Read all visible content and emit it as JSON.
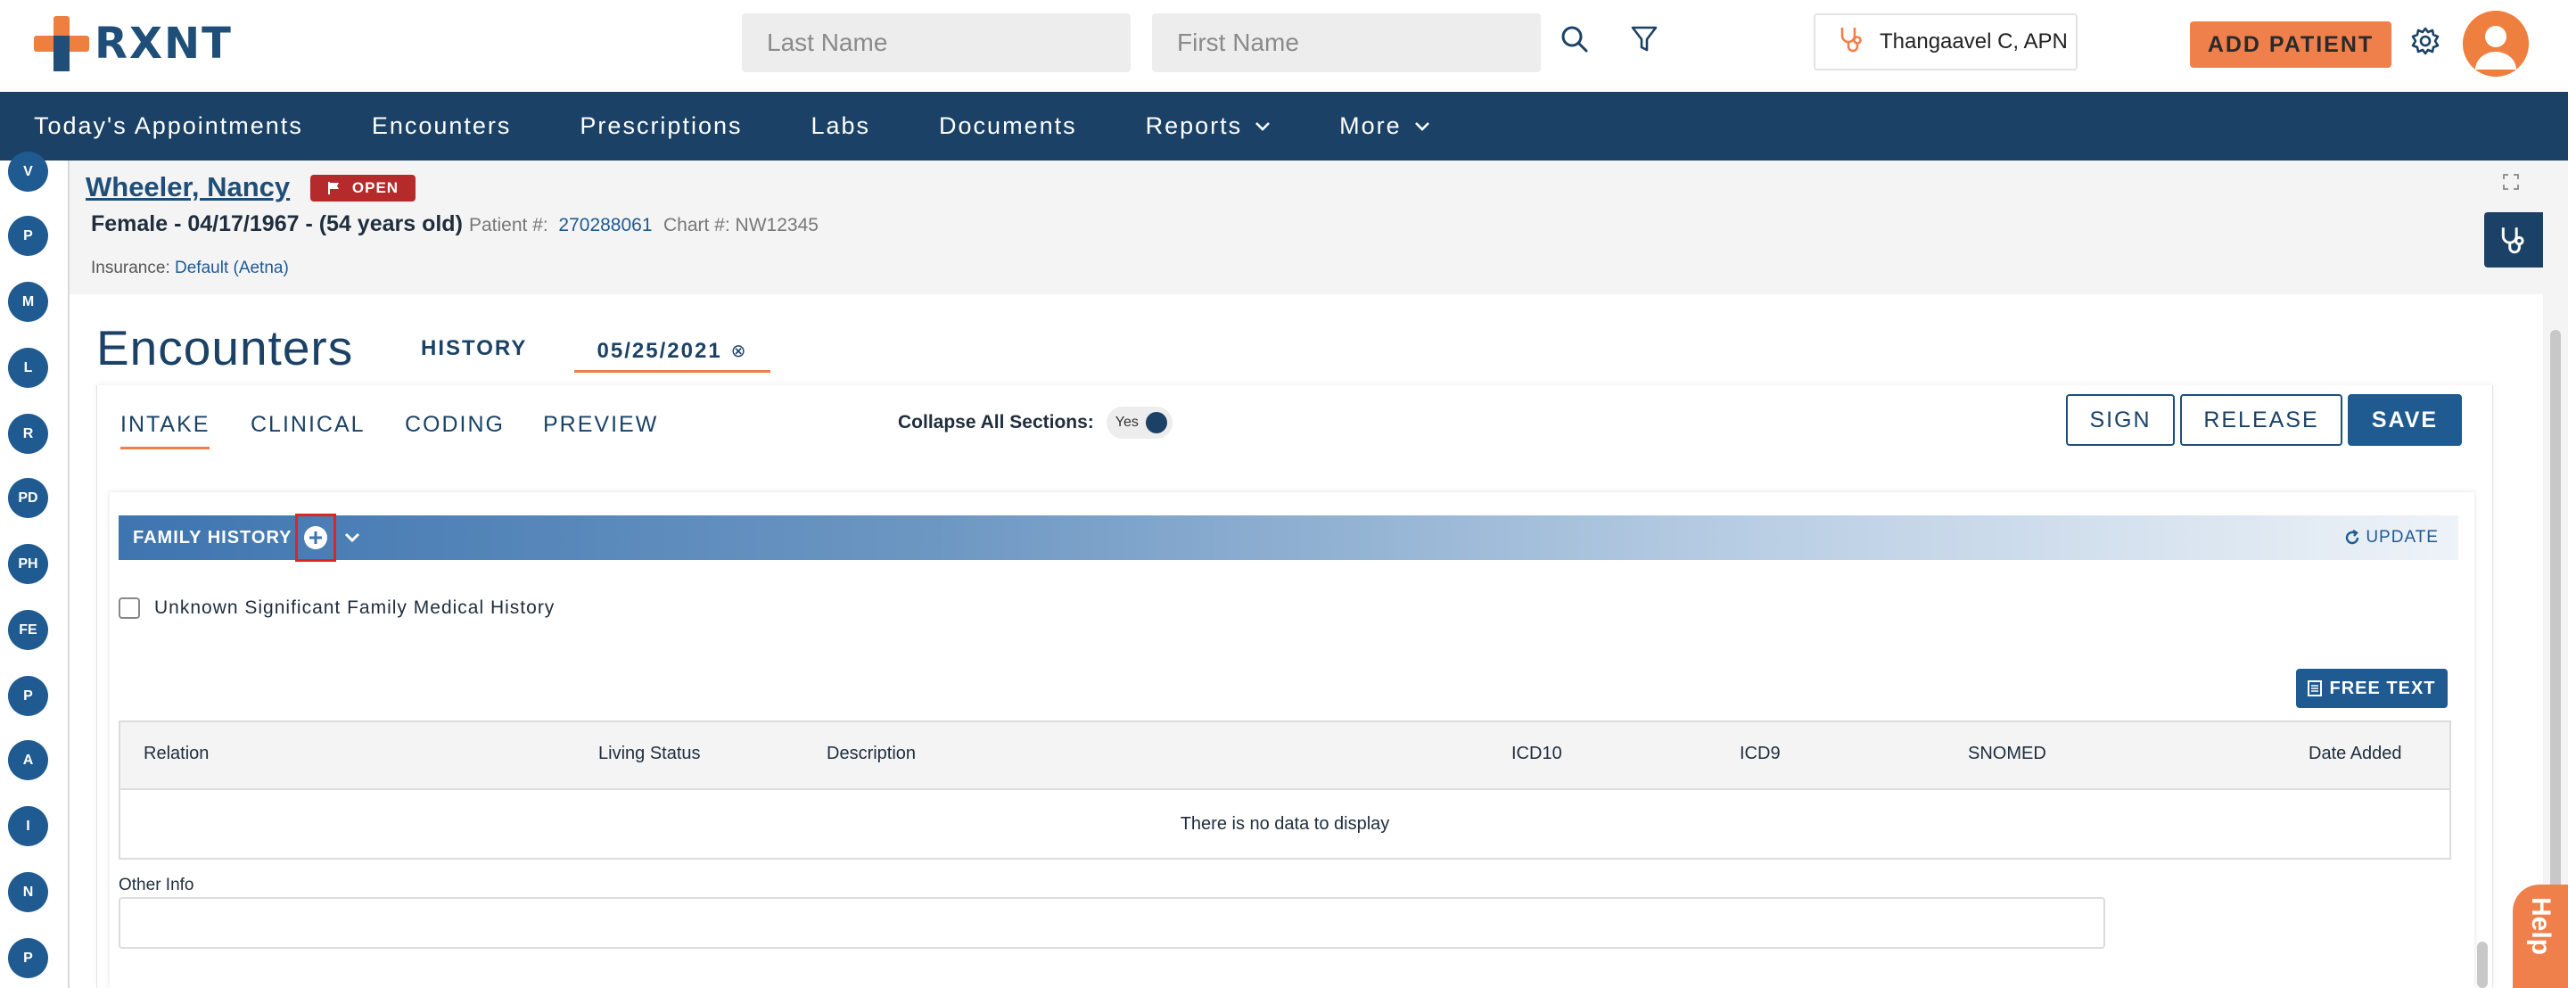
{
  "header": {
    "logo_text": "RXNT",
    "search": {
      "last_name_placeholder": "Last Name",
      "first_name_placeholder": "First Name"
    },
    "provider": "Thangaavel C, APN",
    "add_patient_label": "ADD PATIENT"
  },
  "nav": {
    "items": [
      {
        "label": "Today's Appointments"
      },
      {
        "label": "Encounters"
      },
      {
        "label": "Prescriptions"
      },
      {
        "label": "Labs"
      },
      {
        "label": "Documents"
      },
      {
        "label": "Reports"
      },
      {
        "label": "More"
      }
    ]
  },
  "rail": [
    "V",
    "P",
    "M",
    "L",
    "R",
    "PD",
    "PH",
    "FE",
    "P",
    "A",
    "I",
    "N",
    "P"
  ],
  "patient": {
    "name": "Wheeler, Nancy",
    "status": "OPEN",
    "demographics": "Female - 04/17/1967 - (54 years old)",
    "patient_no_label": "Patient #:",
    "patient_no": "270288061",
    "chart_no_label": "Chart #:",
    "chart_no": "NW12345",
    "insurance_label": "Insurance:",
    "insurance": "Default (Aetna)"
  },
  "encounter": {
    "title": "Encounters",
    "history_tab": "HISTORY",
    "date_tab": "05/25/2021",
    "subtabs": [
      "INTAKE",
      "CLINICAL",
      "CODING",
      "PREVIEW"
    ],
    "collapse_label": "Collapse All Sections:",
    "collapse_value": "Yes",
    "buttons": {
      "sign": "SIGN",
      "release": "RELEASE",
      "save": "SAVE"
    }
  },
  "family_history": {
    "title": "FAMILY HISTORY",
    "update_label": "UPDATE",
    "unknown_label": "Unknown Significant Family Medical History",
    "free_text_label": "FREE TEXT",
    "columns": [
      "Relation",
      "Living Status",
      "Description",
      "ICD10",
      "ICD9",
      "SNOMED",
      "Date Added"
    ],
    "empty_message": "There is no data to display",
    "other_info_label": "Other Info",
    "other_info_value": ""
  },
  "help_label": "Help",
  "colors": {
    "brand_orange": "#ef7f4b",
    "nav_blue": "#1b4266",
    "accent_blue": "#1f5a91",
    "status_red": "#b52a2a"
  }
}
